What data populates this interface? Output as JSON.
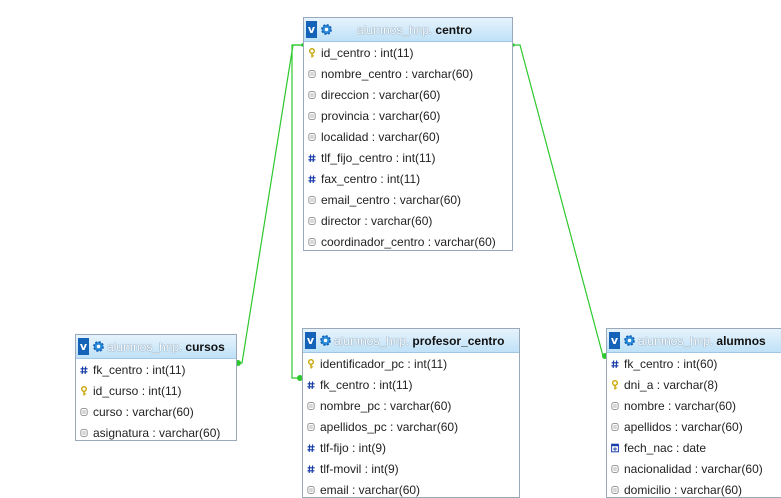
{
  "tables": [
    {
      "id": "centro",
      "db": "alumnos_hnp.",
      "name": "centro",
      "fields": [
        {
          "text": "id_centro : int(11)",
          "icon": "key-icon"
        },
        {
          "text": "nombre_centro : varchar(60)",
          "icon": "text-field-icon"
        },
        {
          "text": "direccion : varchar(60)",
          "icon": "text-field-icon"
        },
        {
          "text": "provincia : varchar(60)",
          "icon": "text-field-icon"
        },
        {
          "text": "localidad : varchar(60)",
          "icon": "text-field-icon"
        },
        {
          "text": "tlf_fijo_centro : int(11)",
          "icon": "numeric-field-icon"
        },
        {
          "text": "fax_centro : int(11)",
          "icon": "numeric-field-icon"
        },
        {
          "text": "email_centro : varchar(60)",
          "icon": "text-field-icon"
        },
        {
          "text": "director : varchar(60)",
          "icon": "text-field-icon"
        },
        {
          "text": "coordinador_centro : varchar(60)",
          "icon": "text-field-icon"
        }
      ]
    },
    {
      "id": "cursos",
      "db": "alumnos_hnp.",
      "name": "cursos",
      "fields": [
        {
          "text": "fk_centro : int(11)",
          "icon": "numeric-field-icon"
        },
        {
          "text": "id_curso : int(11)",
          "icon": "key-icon"
        },
        {
          "text": "curso : varchar(60)",
          "icon": "text-field-icon"
        },
        {
          "text": "asignatura : varchar(60)",
          "icon": "text-field-icon"
        }
      ]
    },
    {
      "id": "profesor_centro",
      "db": "alumnos_hnp.",
      "name": "profesor_centro",
      "fields": [
        {
          "text": "identificador_pc : int(11)",
          "icon": "key-icon"
        },
        {
          "text": "fk_centro : int(11)",
          "icon": "numeric-field-icon"
        },
        {
          "text": "nombre_pc : varchar(60)",
          "icon": "text-field-icon"
        },
        {
          "text": "apellidos_pc : varchar(60)",
          "icon": "text-field-icon"
        },
        {
          "text": "tlf-fijo : int(9)",
          "icon": "numeric-field-icon"
        },
        {
          "text": "tlf-movil : int(9)",
          "icon": "numeric-field-icon"
        },
        {
          "text": "email : varchar(60)",
          "icon": "text-field-icon"
        }
      ]
    },
    {
      "id": "alumnos",
      "db": "alumnos_hnp.",
      "name": "alumnos",
      "fields": [
        {
          "text": "fk_centro : int(60)",
          "icon": "numeric-field-icon"
        },
        {
          "text": "dni_a : varchar(8)",
          "icon": "key-icon"
        },
        {
          "text": "nombre : varchar(60)",
          "icon": "text-field-icon"
        },
        {
          "text": "apellidos : varchar(60)",
          "icon": "text-field-icon"
        },
        {
          "text": "fech_nac : date",
          "icon": "date-field-icon"
        },
        {
          "text": "nacionalidad : varchar(60)",
          "icon": "text-field-icon"
        },
        {
          "text": "domicilio : varchar(60)",
          "icon": "text-field-icon"
        }
      ]
    }
  ],
  "relations": [
    {
      "from": "centro",
      "to": "cursos",
      "label": "centro.id_centro → cursos.fk_centro"
    },
    {
      "from": "centro",
      "to": "profesor_centro",
      "label": "centro.id_centro → profesor_centro.fk_centro"
    },
    {
      "from": "centro",
      "to": "alumnos",
      "label": "centro.id_centro → alumnos.fk_centro"
    }
  ],
  "colors": {
    "relation_line": "#2ec82e",
    "header_blue": "#1463b8",
    "numeric_icon": "#1a3fa8",
    "key_icon": "#c8a400"
  }
}
